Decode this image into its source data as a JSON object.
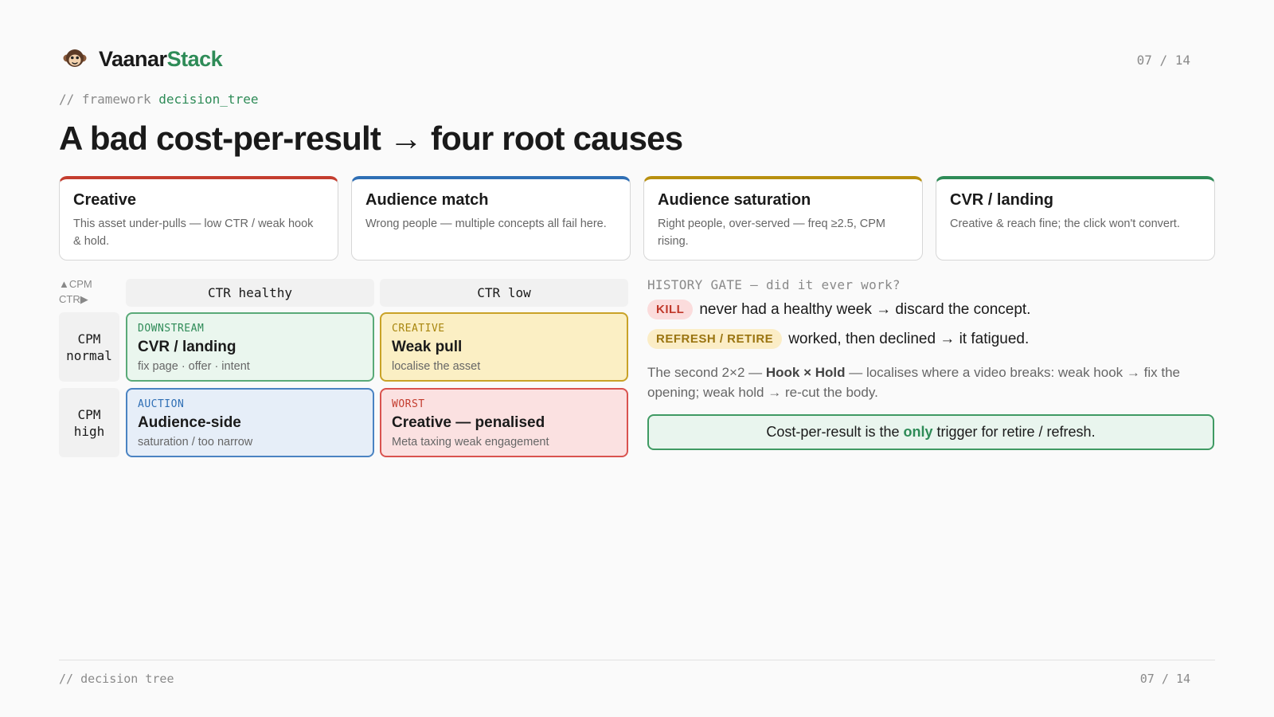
{
  "brand": {
    "name_main": "Vaanar",
    "name_accent": "Stack",
    "accent_color": "#2e8b57",
    "logo_icon": "monkey-icon"
  },
  "page": {
    "current": "07",
    "total": "14",
    "separator": " / "
  },
  "kicker": {
    "prefix": "// framework ",
    "highlight": "decision_tree"
  },
  "title": "A bad cost-per-result → four root causes",
  "causes": [
    {
      "title": "Creative",
      "desc": "This asset under-pulls — low CTR / weak hook & hold.",
      "color": "#c43d2f"
    },
    {
      "title": "Audience match",
      "desc": "Wrong people — multiple concepts all fail here.",
      "color": "#2f6fb5"
    },
    {
      "title": "Audience saturation",
      "desc": "Right people, over-served — freq ≥2.5, CPM rising.",
      "color": "#b8900f"
    },
    {
      "title": "CVR / landing",
      "desc": "Creative & reach fine; the click won't convert.",
      "color": "#2e8b57"
    }
  ],
  "matrix": {
    "axis_cpm": "▲CPM",
    "axis_ctr": "CTR▶",
    "col_headers": [
      "CTR healthy",
      "CTR low"
    ],
    "row_headers": [
      {
        "line1": "CPM",
        "line2": "normal"
      },
      {
        "line1": "CPM",
        "line2": "high"
      }
    ],
    "cells": [
      {
        "tag": "DOWNSTREAM",
        "title": "CVR / landing",
        "sub": "fix page · offer · intent",
        "bg": "#eaf6ee",
        "border": "#5aaa78",
        "tag_color": "#2e8b57"
      },
      {
        "tag": "CREATIVE",
        "title": "Weak pull",
        "sub": "localise the asset",
        "bg": "#fbefc4",
        "border": "#c9a227",
        "tag_color": "#a8860e"
      },
      {
        "tag": "AUCTION",
        "title": "Audience-side",
        "sub": "saturation / too narrow",
        "bg": "#e6eef8",
        "border": "#4a83c2",
        "tag_color": "#2f6fb5"
      },
      {
        "tag": "WORST",
        "title": "Creative — penalised",
        "sub": "Meta taxing weak engagement",
        "bg": "#fbe1e1",
        "border": "#d9534f",
        "tag_color": "#c43d2f"
      }
    ]
  },
  "history_gate": {
    "heading": "HISTORY GATE — did it ever work?",
    "rows": [
      {
        "pill": "KILL",
        "text": "never had a healthy week → discard the concept.",
        "pill_bg": "#fbdcdc",
        "pill_color": "#c0392b"
      },
      {
        "pill": "REFRESH / RETIRE",
        "text": "worked, then declined → it fatigued.",
        "pill_bg": "#fbedc6",
        "pill_color": "#9a7410"
      }
    ]
  },
  "note": {
    "before": "The second 2×2 — ",
    "bold": "Hook × Hold",
    "after": " — localises where a video breaks: weak hook → fix the opening; weak hold → re-cut the body."
  },
  "callout": {
    "before": "Cost-per-result is the ",
    "emphasis": "only",
    "after": " trigger for retire / refresh."
  },
  "footer": {
    "label": "// decision tree"
  }
}
